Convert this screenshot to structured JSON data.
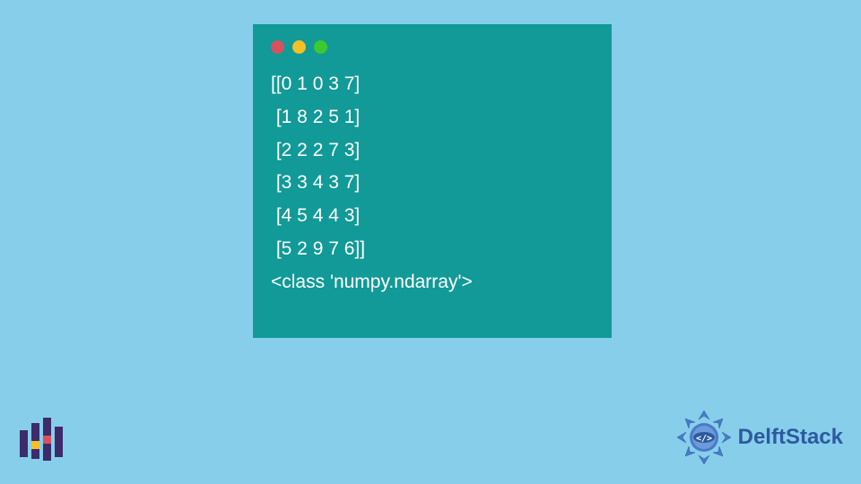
{
  "terminal": {
    "lines": [
      "[[0 1 0 3 7]",
      " [1 8 2 5 1]",
      " [2 2 2 7 3]",
      " [3 3 4 3 7]",
      " [4 5 4 4 3]",
      " [5 2 9 7 6]]",
      "<class 'numpy.ndarray'>"
    ]
  },
  "brand": {
    "name": "DelftStack"
  }
}
